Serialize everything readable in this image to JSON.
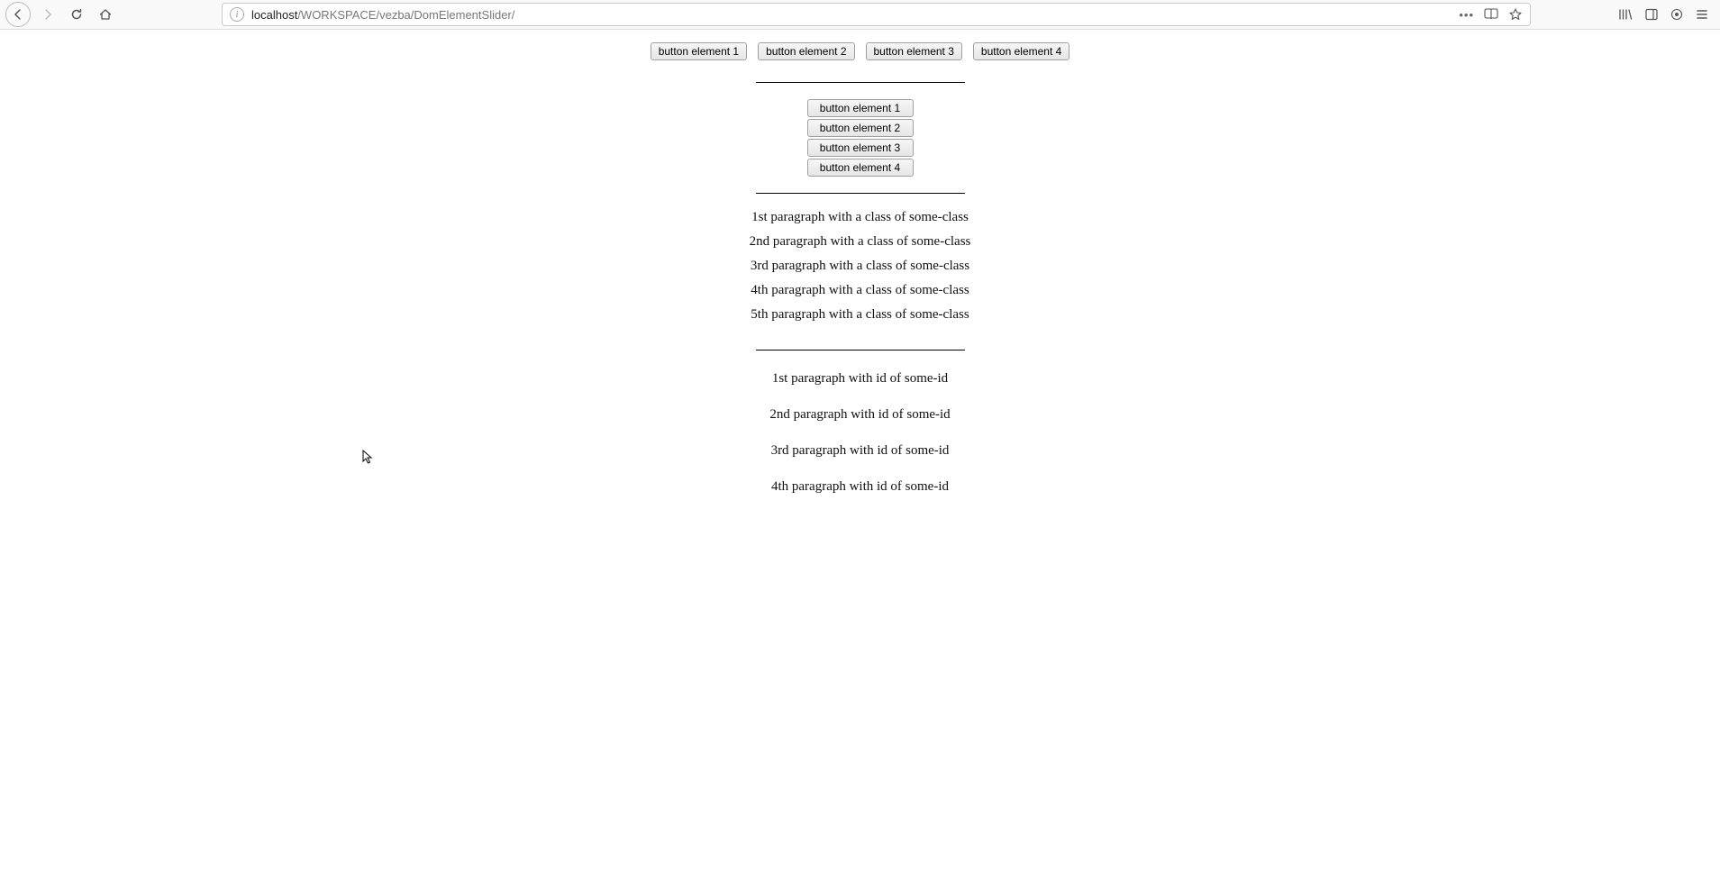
{
  "browser": {
    "url_host": "localhost",
    "url_path": "/WORKSPACE/vezba/DomElementSlider/"
  },
  "buttons_row": [
    "button element 1",
    "button element 2",
    "button element 3",
    "button element 4"
  ],
  "buttons_col": [
    "button element 1",
    "button element 2",
    "button element 3",
    "button element 4"
  ],
  "class_paragraphs": [
    "1st paragraph with a class of some-class",
    "2nd paragraph with a class of some-class",
    "3rd paragraph with a class of some-class",
    "4th paragraph with a class of some-class",
    "5th paragraph with a class of some-class"
  ],
  "id_paragraphs": [
    "1st paragraph with id of some-id",
    "2nd paragraph with id of some-id",
    "3rd paragraph with id of some-id",
    "4th paragraph with id of some-id"
  ]
}
